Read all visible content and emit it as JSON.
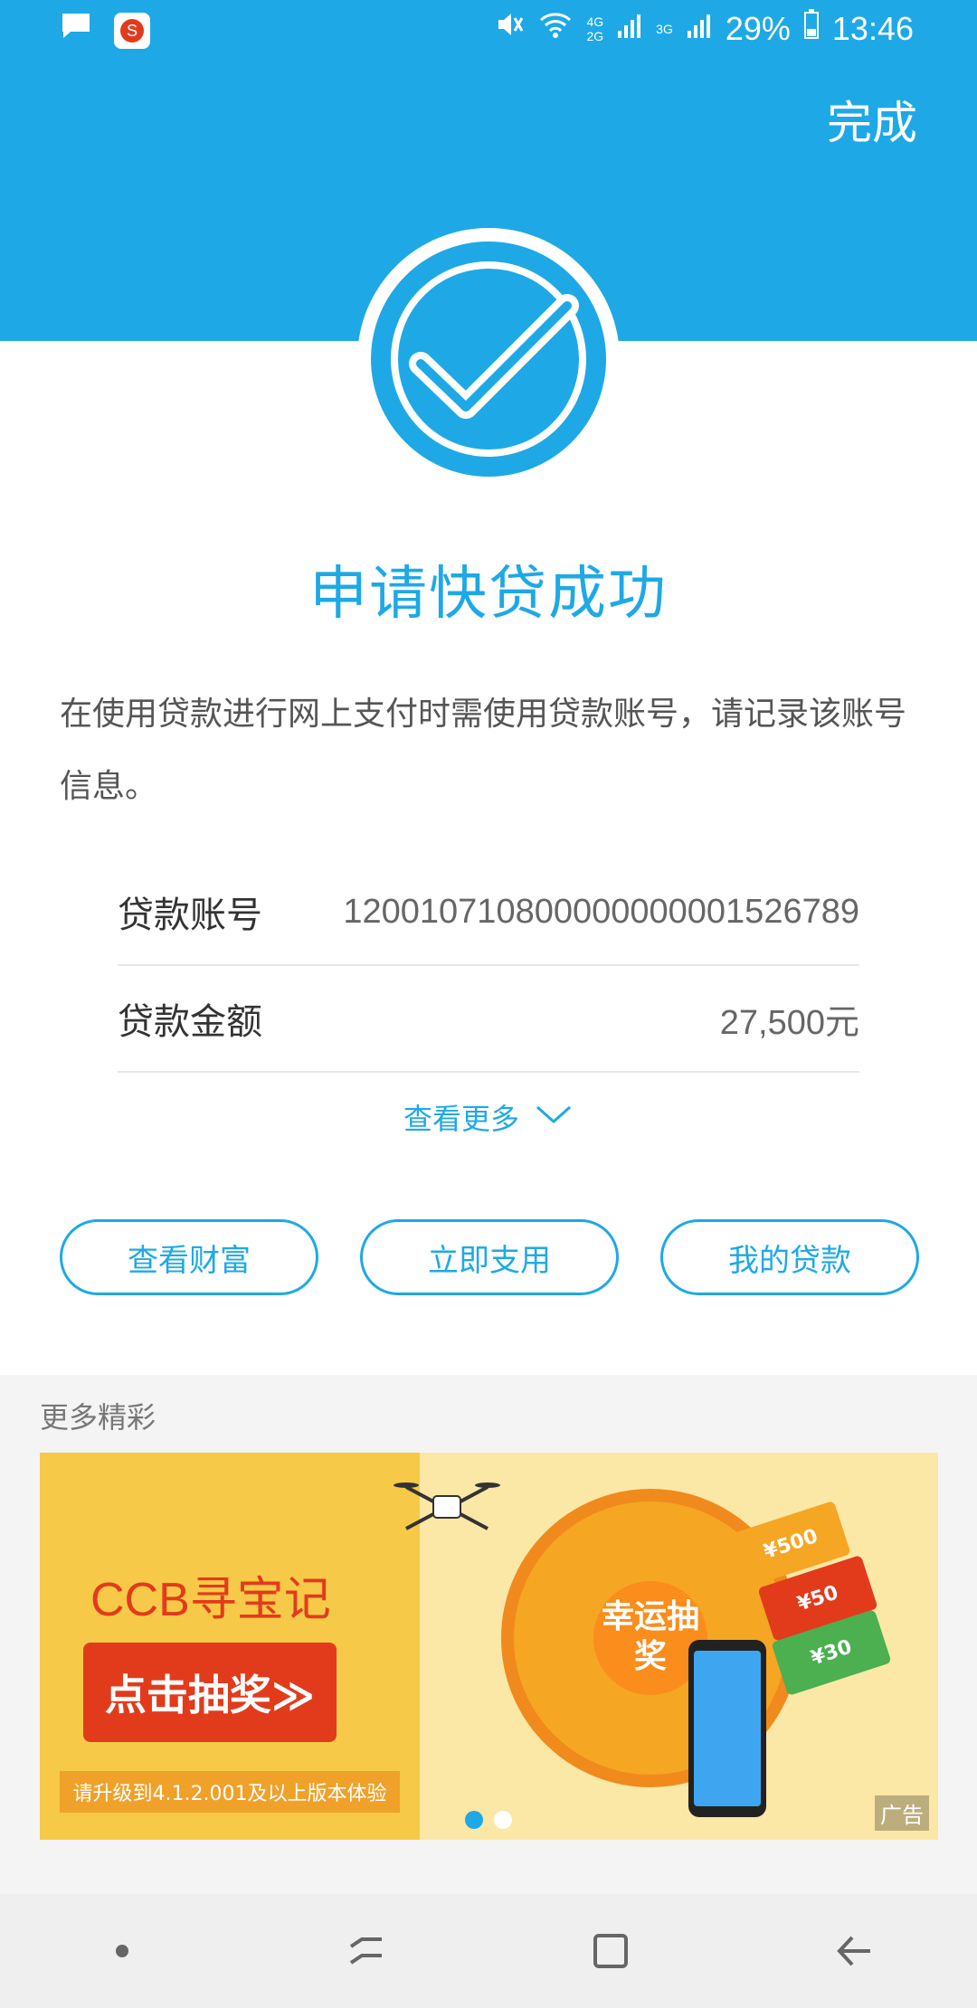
{
  "status_bar": {
    "battery": "29%",
    "time": "13:46",
    "network_1": "4G",
    "network_2": "2G",
    "network_3": "3G"
  },
  "header": {
    "done_label": "完成"
  },
  "result": {
    "title": "申请快贷成功",
    "description": "在使用贷款进行网上支付时需使用贷款账号，请记录该账号信息。"
  },
  "details": [
    {
      "label": "贷款账号",
      "value": "120010710800000000001526789"
    },
    {
      "label": "贷款金额",
      "value": "27,500元"
    }
  ],
  "more_link": "查看更多",
  "actions": [
    {
      "label": "查看财富"
    },
    {
      "label": "立即支用"
    },
    {
      "label": "我的贷款"
    }
  ],
  "more_section": {
    "title": "更多精彩",
    "banner": {
      "headline": "CCB寻宝记",
      "cta": "点击抽奖≫",
      "note": "请升级到4.1.2.001及以上版本体验",
      "wheel_text": "幸运抽奖",
      "ad_tag": "广告",
      "ticket_1": "¥500",
      "ticket_2": "¥50",
      "ticket_3": "¥30",
      "dots_total": 2,
      "dot_active": 1
    }
  },
  "colors": {
    "brand": "#1ea9e6",
    "banner_red": "#e23b1c"
  }
}
